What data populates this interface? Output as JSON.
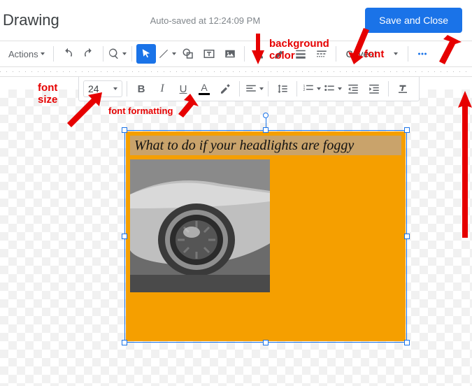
{
  "header": {
    "title": "Drawing",
    "autosave": "Auto-saved at 12:24:09 PM",
    "save_button": "Save and Close"
  },
  "toolbar": {
    "actions_label": "Actions",
    "font_name": "Caveat",
    "font_size": "24"
  },
  "canvas": {
    "textbox_content": "What to do if your headlights are foggy",
    "shape_fill": "#f59f00",
    "text_bg": "#c9a36b"
  },
  "annotations": {
    "bg_color": "background color",
    "font": "font",
    "font_size": "font size",
    "font_formatting": "font formatting"
  }
}
